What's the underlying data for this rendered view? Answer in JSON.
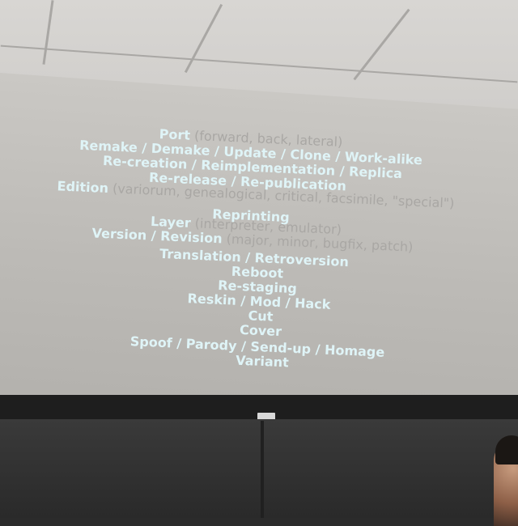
{
  "slide": {
    "lines": [
      {
        "main": "Port",
        "note": "(forward, back, lateral)"
      },
      {
        "main": "Remake / Demake / Update / Clone / Work-alike",
        "note": ""
      },
      {
        "main": "Re-creation / Reimplementation / Replica",
        "note": ""
      },
      {
        "main": "Re-release / Re-publication",
        "note": ""
      },
      {
        "main": "Edition",
        "note": "(variorum, genealogical, critical, facsimile, \"special\")"
      },
      {
        "main": "Reprinting",
        "note": ""
      },
      {
        "main": "Layer",
        "note": "(interpreter, emulator)"
      },
      {
        "main": "Version / Revision",
        "note": "(major, minor, bugfix, patch)"
      },
      {
        "main": "Translation / Retroversion",
        "note": ""
      },
      {
        "main": "Reboot",
        "note": ""
      },
      {
        "main": "Re-staging",
        "note": ""
      },
      {
        "main": "Reskin / Mod / Hack",
        "note": ""
      },
      {
        "main": "Cut",
        "note": ""
      },
      {
        "main": "Cover",
        "note": ""
      },
      {
        "main": "Spoof / Parody / Send-up / Homage",
        "note": ""
      },
      {
        "main": "Variant",
        "note": ""
      }
    ]
  },
  "colors": {
    "highlight": "#dff4f7",
    "dim": "#a9a7a4"
  }
}
